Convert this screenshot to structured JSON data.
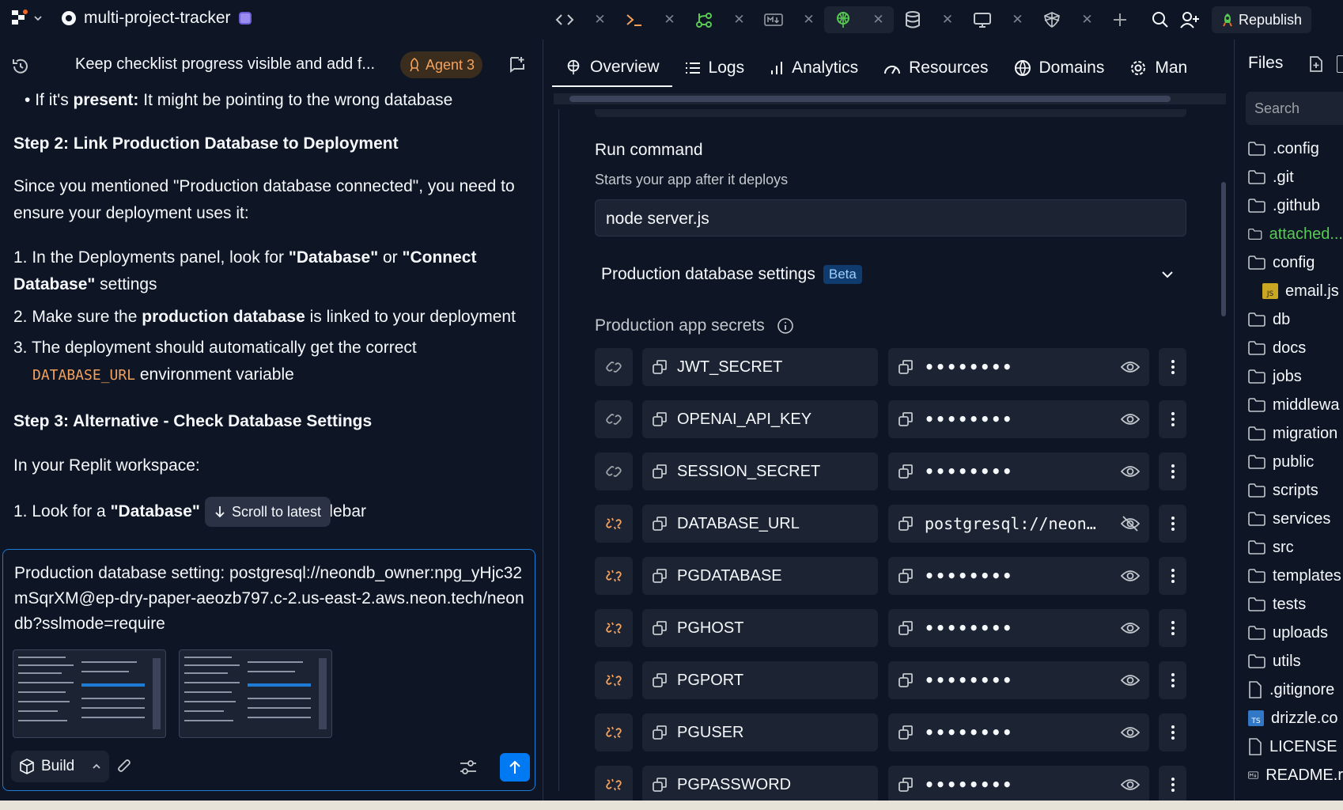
{
  "app": {
    "project_name": "multi-project-tracker",
    "republish_label": "Republish"
  },
  "chat": {
    "title": "Keep checklist progress visible and add f...",
    "agent_badge": "Agent 3",
    "bullet_prefix": "If it's ",
    "bullet_bold": "present:",
    "bullet_rest": " It might be pointing to the wrong database",
    "step2": "Step 2: Link Production Database to Deployment",
    "para2": "Since you mentioned \"Production database connected\", you need to ensure your deployment uses it:",
    "li1_a": "1. In the Deployments panel, look for ",
    "li1_b": "\"Database\"",
    "li1_c": " or ",
    "li1_d": "\"Connect Database\"",
    "li1_e": " settings",
    "li2_a": "2. Make sure the ",
    "li2_b": "production database",
    "li2_c": " is linked to your deployment",
    "li3_a": "3. The deployment should automatically get the correct",
    "li3_code": "DATABASE_URL",
    "li3_c": " environment variable",
    "step3": "Step 3: Alternative - Check Database Settings",
    "para3": "In your Replit workspace:",
    "li4_a": "1. Look for a ",
    "li4_b": "\"Database\"",
    "li4_c": " icon in the left sidebar",
    "scroll_latest": "Scroll to latest",
    "composer_text": "Production database setting: postgresql://neondb_owner:npg_yHjc32mSqrXM@ep-dry-paper-aeozb797.c-2.us-east-2.aws.neon.tech/neondb?sslmode=require",
    "build_label": "Build"
  },
  "mid_tabs": [
    "Overview",
    "Logs",
    "Analytics",
    "Resources",
    "Domains",
    "Man"
  ],
  "deploy": {
    "run_command_title": "Run command",
    "run_command_sub": "Starts your app after it deploys",
    "run_command_value": "node server.js",
    "db_settings_title": "Production database settings",
    "beta": "Beta",
    "secrets_title": "Production app secrets",
    "secrets": [
      {
        "key": "JWT_SECRET",
        "value": "••••••••"
      },
      {
        "key": "OPENAI_API_KEY",
        "value": "••••••••"
      },
      {
        "key": "SESSION_SECRET",
        "value": "••••••••"
      },
      {
        "key": "DATABASE_URL",
        "value": "postgresql://neon…"
      },
      {
        "key": "PGDATABASE",
        "value": "••••••••"
      },
      {
        "key": "PGHOST",
        "value": "••••••••"
      },
      {
        "key": "PGPORT",
        "value": "••••••••"
      },
      {
        "key": "PGUSER",
        "value": "••••••••"
      },
      {
        "key": "PGPASSWORD",
        "value": "••••••••"
      }
    ]
  },
  "files": {
    "title": "Files",
    "search_placeholder": "Search",
    "items": [
      ".config",
      ".git",
      ".github",
      "attached...",
      "config",
      "email.js",
      "db",
      "docs",
      "jobs",
      "middlewa",
      "migration",
      "public",
      "scripts",
      "services",
      "src",
      "templates",
      "tests",
      "uploads",
      "utils",
      ".gitignore",
      "drizzle.co",
      "LICENSE",
      "README.r"
    ]
  }
}
